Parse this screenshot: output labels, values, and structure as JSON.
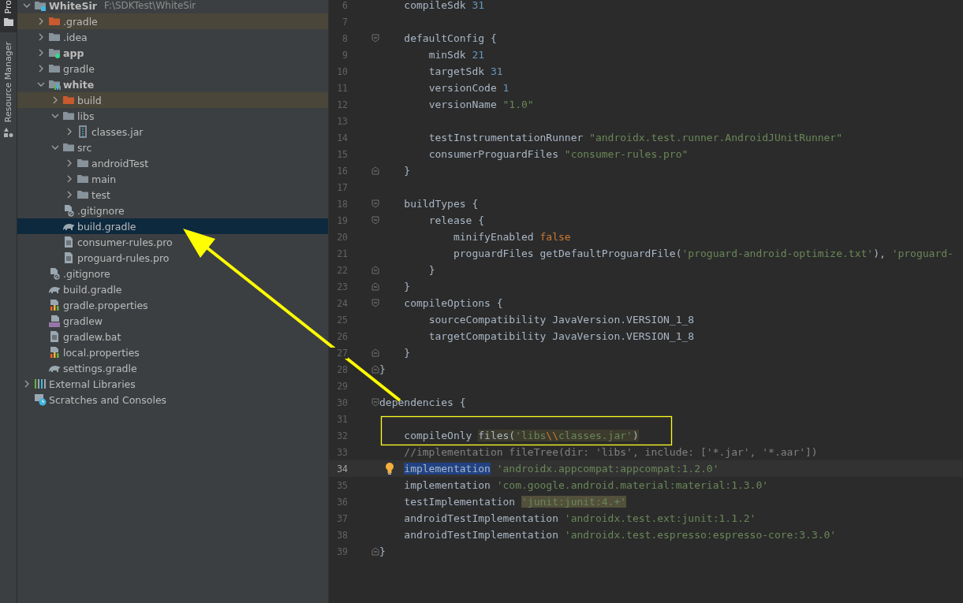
{
  "tool_strip": [
    {
      "label": "Pro",
      "kind": "project",
      "selected": true
    },
    {
      "label": "Resource Manager",
      "kind": "resources",
      "selected": false
    }
  ],
  "tree": [
    {
      "label": "WhiteSir",
      "path": "F:\\SDKTest\\WhiteSir",
      "kind": "project",
      "expanded": true,
      "selected": false,
      "excluded": false,
      "children": [
        {
          "label": ".gradle",
          "kind": "folder",
          "expanded": false,
          "selected": false,
          "excluded": true
        },
        {
          "label": ".idea",
          "kind": "folder",
          "expanded": false,
          "selected": false,
          "excluded": false
        },
        {
          "label": "app",
          "kind": "app",
          "expanded": false,
          "selected": false,
          "excluded": false
        },
        {
          "label": "gradle",
          "kind": "folder",
          "expanded": false,
          "selected": false,
          "excluded": false
        },
        {
          "label": "white",
          "kind": "module",
          "expanded": true,
          "selected": false,
          "excluded": false,
          "children": [
            {
              "label": "build",
              "kind": "folder",
              "expanded": false,
              "selected": false,
              "excluded": true
            },
            {
              "label": "libs",
              "kind": "folder",
              "expanded": true,
              "selected": false,
              "excluded": false,
              "children": [
                {
                  "label": "classes.jar",
                  "kind": "jar",
                  "expanded": false,
                  "selected": false,
                  "excluded": false
                }
              ]
            },
            {
              "label": "src",
              "kind": "folder",
              "expanded": true,
              "selected": false,
              "excluded": false,
              "children": [
                {
                  "label": "androidTest",
                  "kind": "folder",
                  "expanded": false,
                  "selected": false,
                  "excluded": false
                },
                {
                  "label": "main",
                  "kind": "folder",
                  "expanded": false,
                  "selected": false,
                  "excluded": false
                },
                {
                  "label": "test",
                  "kind": "folder",
                  "expanded": false,
                  "selected": false,
                  "excluded": false
                }
              ]
            },
            {
              "label": ".gitignore",
              "kind": "ignore",
              "selected": false,
              "excluded": false
            },
            {
              "label": "build.gradle",
              "kind": "gradle",
              "selected": true,
              "excluded": false
            },
            {
              "label": "consumer-rules.pro",
              "kind": "text",
              "selected": false,
              "excluded": false
            },
            {
              "label": "proguard-rules.pro",
              "kind": "text",
              "selected": false,
              "excluded": false
            }
          ]
        },
        {
          "label": ".gitignore",
          "kind": "ignore",
          "selected": false,
          "excluded": false
        },
        {
          "label": "build.gradle",
          "kind": "gradle",
          "selected": false,
          "excluded": false
        },
        {
          "label": "gradle.properties",
          "kind": "properties",
          "selected": false,
          "excluded": false
        },
        {
          "label": "gradlew",
          "kind": "script",
          "selected": false,
          "excluded": false
        },
        {
          "label": "gradlew.bat",
          "kind": "text",
          "selected": false,
          "excluded": false
        },
        {
          "label": "local.properties",
          "kind": "properties",
          "selected": false,
          "excluded": false
        },
        {
          "label": "settings.gradle",
          "kind": "gradle",
          "selected": false,
          "excluded": false
        }
      ]
    },
    {
      "label": "External Libraries",
      "kind": "libraries",
      "expanded": false,
      "selected": false,
      "excluded": false
    },
    {
      "label": "Scratches and Consoles",
      "kind": "scratches",
      "selected": false,
      "excluded": false
    }
  ],
  "editor": {
    "lines": [
      {
        "number": "6",
        "current": false,
        "segments": [
          {
            "kind": "plain",
            "text": "    compileSdk "
          },
          {
            "kind": "number",
            "text": "31"
          }
        ]
      },
      {
        "number": "7",
        "current": false
      },
      {
        "number": "8",
        "current": false,
        "fold_open": true,
        "segments": [
          {
            "kind": "plain",
            "text": "    defaultConfig {"
          }
        ]
      },
      {
        "number": "9",
        "current": false,
        "segments": [
          {
            "kind": "plain",
            "text": "        minSdk "
          },
          {
            "kind": "number",
            "text": "21"
          }
        ]
      },
      {
        "number": "10",
        "current": false,
        "segments": [
          {
            "kind": "plain",
            "text": "        targetSdk "
          },
          {
            "kind": "number",
            "text": "31"
          }
        ]
      },
      {
        "number": "11",
        "current": false,
        "segments": [
          {
            "kind": "plain",
            "text": "        versionCode "
          },
          {
            "kind": "number",
            "text": "1"
          }
        ]
      },
      {
        "number": "12",
        "current": false,
        "segments": [
          {
            "kind": "plain",
            "text": "        versionName "
          },
          {
            "kind": "string",
            "text": "\"1.0\""
          }
        ]
      },
      {
        "number": "13",
        "current": false
      },
      {
        "number": "14",
        "current": false,
        "segments": [
          {
            "kind": "plain",
            "text": "        testInstrumentationRunner "
          },
          {
            "kind": "string",
            "text": "\"androidx.test.runner.AndroidJUnitRunner\""
          }
        ]
      },
      {
        "number": "15",
        "current": false,
        "segments": [
          {
            "kind": "plain",
            "text": "        consumerProguardFiles "
          },
          {
            "kind": "string",
            "text": "\"consumer-rules.pro\""
          }
        ]
      },
      {
        "number": "16",
        "current": false,
        "fold_close": true,
        "segments": [
          {
            "kind": "plain",
            "text": "    }"
          }
        ]
      },
      {
        "number": "17",
        "current": false
      },
      {
        "number": "18",
        "current": false,
        "fold_open": true,
        "segments": [
          {
            "kind": "plain",
            "text": "    buildTypes {"
          }
        ]
      },
      {
        "number": "19",
        "current": false,
        "fold_open": true,
        "segments": [
          {
            "kind": "plain",
            "text": "        release {"
          }
        ]
      },
      {
        "number": "20",
        "current": false,
        "segments": [
          {
            "kind": "plain",
            "text": "            minifyEnabled "
          },
          {
            "kind": "keyword",
            "text": "false"
          }
        ]
      },
      {
        "number": "21",
        "current": false,
        "segments": [
          {
            "kind": "plain",
            "text": "            proguardFiles getDefaultProguardFile("
          },
          {
            "kind": "string",
            "text": "'proguard-android-optimize.txt'"
          },
          {
            "kind": "plain",
            "text": "), "
          },
          {
            "kind": "string",
            "text": "'proguard-"
          }
        ]
      },
      {
        "number": "22",
        "current": false,
        "fold_close": true,
        "segments": [
          {
            "kind": "plain",
            "text": "        }"
          }
        ]
      },
      {
        "number": "23",
        "current": false,
        "fold_close": true,
        "segments": [
          {
            "kind": "plain",
            "text": "    }"
          }
        ]
      },
      {
        "number": "24",
        "current": false,
        "fold_open": true,
        "segments": [
          {
            "kind": "plain",
            "text": "    compileOptions {"
          }
        ]
      },
      {
        "number": "25",
        "current": false,
        "segments": [
          {
            "kind": "plain",
            "text": "        sourceCompatibility JavaVersion.VERSION_1_8"
          }
        ]
      },
      {
        "number": "26",
        "current": false,
        "segments": [
          {
            "kind": "plain",
            "text": "        targetCompatibility JavaVersion.VERSION_1_8"
          }
        ]
      },
      {
        "number": "27",
        "current": false,
        "fold_close": true,
        "segments": [
          {
            "kind": "plain",
            "text": "    }"
          }
        ]
      },
      {
        "number": "28",
        "current": false,
        "fold_close": true,
        "segments": [
          {
            "kind": "plain",
            "text": "}"
          }
        ]
      },
      {
        "number": "29",
        "current": false
      },
      {
        "number": "30",
        "current": false,
        "fold_open": true,
        "segments": [
          {
            "kind": "plain",
            "text": "dependencies {"
          }
        ]
      },
      {
        "number": "31",
        "current": false
      },
      {
        "number": "32",
        "current": false,
        "segments": [
          {
            "kind": "plain",
            "text": "    compileOnly "
          },
          {
            "kind": "plain",
            "text": "files(",
            "highlighted": true
          },
          {
            "kind": "string",
            "text": "'libs",
            "highlighted": true
          },
          {
            "kind": "keyword",
            "text": "\\\\",
            "highlighted": true
          },
          {
            "kind": "string",
            "text": "classes.jar'",
            "highlighted": true
          },
          {
            "kind": "plain",
            "text": ")",
            "highlighted": true
          }
        ]
      },
      {
        "number": "33",
        "current": false,
        "segments": [
          {
            "kind": "comment",
            "text": "    //implementation fileTree(dir: 'libs', include: ['*.jar', '*.aar'])"
          }
        ]
      },
      {
        "number": "34",
        "current": true,
        "bulb": true,
        "segments": [
          {
            "kind": "plain",
            "text": "    implementation",
            "selected": true
          },
          {
            "kind": "string",
            "text": " 'androidx.appcompat:appcompat:1.2.0'"
          }
        ]
      },
      {
        "number": "35",
        "current": false,
        "segments": [
          {
            "kind": "plain",
            "text": "    implementation "
          },
          {
            "kind": "string",
            "text": "'com.google.android.material:material:1.3.0'"
          }
        ]
      },
      {
        "number": "36",
        "current": false,
        "segments": [
          {
            "kind": "plain",
            "text": "    testImplementation "
          },
          {
            "kind": "string",
            "text": "'junit:junit:4.+'",
            "warning": true
          }
        ]
      },
      {
        "number": "37",
        "current": false,
        "segments": [
          {
            "kind": "plain",
            "text": "    androidTestImplementation "
          },
          {
            "kind": "string",
            "text": "'androidx.test.ext:junit:1.1.2'"
          }
        ]
      },
      {
        "number": "38",
        "current": false,
        "segments": [
          {
            "kind": "plain",
            "text": "    androidTestImplementation "
          },
          {
            "kind": "string",
            "text": "'androidx.test.espresso:espresso-core:3.3.0'"
          }
        ]
      },
      {
        "number": "39",
        "current": false,
        "fold_close": true,
        "segments": [
          {
            "kind": "plain",
            "text": "}"
          }
        ]
      }
    ]
  },
  "annotations": {
    "arrow": true,
    "frame": true
  }
}
